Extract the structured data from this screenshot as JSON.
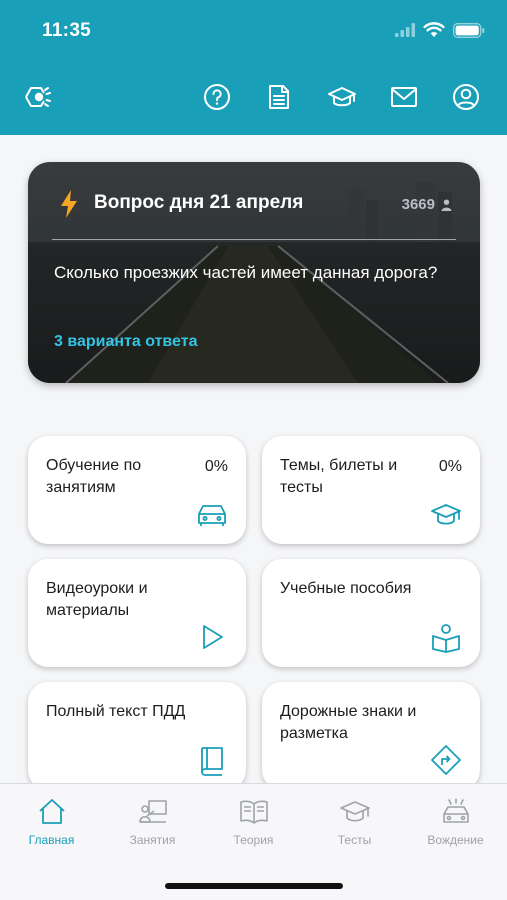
{
  "status_bar": {
    "time": "11:35"
  },
  "header": {
    "icons": [
      "logo-icon",
      "help-icon",
      "document-icon",
      "graduation-cap-icon",
      "mail-icon",
      "profile-icon"
    ]
  },
  "question_of_day": {
    "title": "Вопрос дня 21 апреля",
    "count": "3669",
    "question": "Сколько проезжих частей имеет данная дорога?",
    "answers_link": "3 варианта ответа"
  },
  "tiles": [
    {
      "label": "Обучение по занятиям",
      "percent": "0%",
      "icon": "car-icon"
    },
    {
      "label": "Темы, билеты и тесты",
      "percent": "0%",
      "icon": "graduation-cap-icon"
    },
    {
      "label": "Видеоуроки и материалы",
      "icon": "play-icon"
    },
    {
      "label": "Учебные пособия",
      "icon": "reader-icon"
    },
    {
      "label": "Полный текст ПДД",
      "icon": "book-icon"
    },
    {
      "label": "Дорожные знаки и разметка",
      "icon": "road-sign-icon"
    }
  ],
  "tabbar": {
    "tabs": [
      {
        "label": "Главная",
        "icon": "home-icon",
        "active": true
      },
      {
        "label": "Занятия",
        "icon": "lesson-icon",
        "active": false
      },
      {
        "label": "Теория",
        "icon": "open-book-icon",
        "active": false
      },
      {
        "label": "Тесты",
        "icon": "graduation-cap-icon",
        "active": false
      },
      {
        "label": "Вождение",
        "icon": "driving-icon",
        "active": false
      }
    ]
  },
  "colors": {
    "accent": "#1a9fb8",
    "link": "#33c3e3",
    "bolt": "#f5a623"
  }
}
